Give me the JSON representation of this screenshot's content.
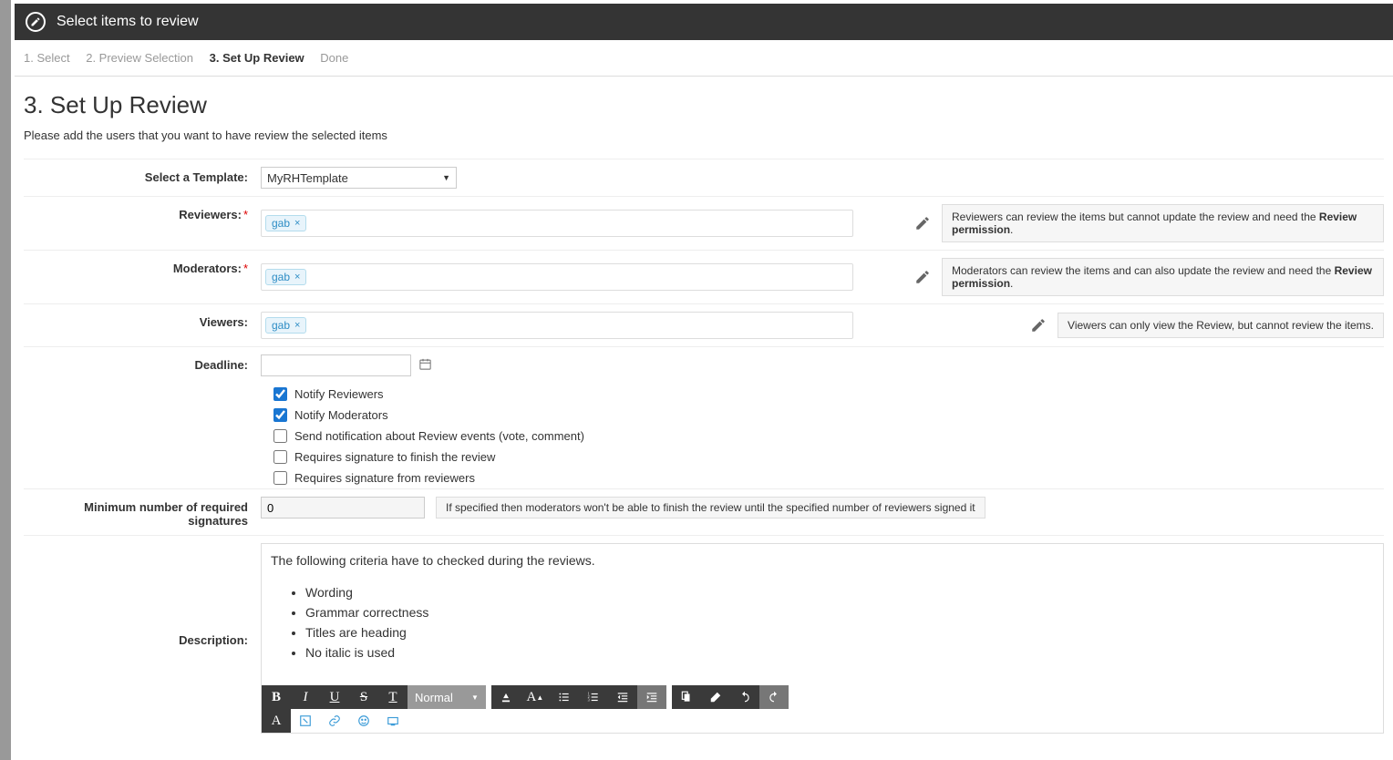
{
  "header": {
    "title": "Select items to review"
  },
  "steps": {
    "s1": "1. Select",
    "s2": "2. Preview Selection",
    "s3": "3. Set Up Review",
    "s4": "Done"
  },
  "page": {
    "title": "3. Set Up Review",
    "subtitle": "Please add the users that you want to have review the selected items"
  },
  "labels": {
    "template": "Select a Template:",
    "reviewers": "Reviewers:",
    "moderators": "Moderators:",
    "viewers": "Viewers:",
    "deadline": "Deadline:",
    "minSig": "Minimum number of required signatures",
    "description": "Description:"
  },
  "template": {
    "selected": "MyRHTemplate"
  },
  "reviewers": {
    "tag": "gab",
    "info_prefix": "Reviewers can review the items but cannot update the review and need the ",
    "info_bold": "Review permission",
    "info_suffix": "."
  },
  "moderators": {
    "tag": "gab",
    "info_prefix": "Moderators can review the items and can also update the review and need the ",
    "info_bold": "Review permission",
    "info_suffix": "."
  },
  "viewers": {
    "tag": "gab",
    "info": "Viewers can only view the Review, but cannot review the items."
  },
  "checks": {
    "notifyReviewers": "Notify Reviewers",
    "notifyModerators": "Notify Moderators",
    "sendNotif": "Send notification about Review events (vote, comment)",
    "reqSig": "Requires signature to finish the review",
    "reqSigReviewers": "Requires signature from reviewers"
  },
  "minSig": {
    "value": "0",
    "hint": "If specified then moderators won't be able to finish the review until the specified number of reviewers signed it"
  },
  "desc": {
    "intro": "The following criteria have to checked during the reviews.",
    "items": [
      "Wording",
      "Grammar correctness",
      "Titles are heading",
      "No italic is used"
    ]
  },
  "toolbar": {
    "formatSelect": "Normal"
  }
}
